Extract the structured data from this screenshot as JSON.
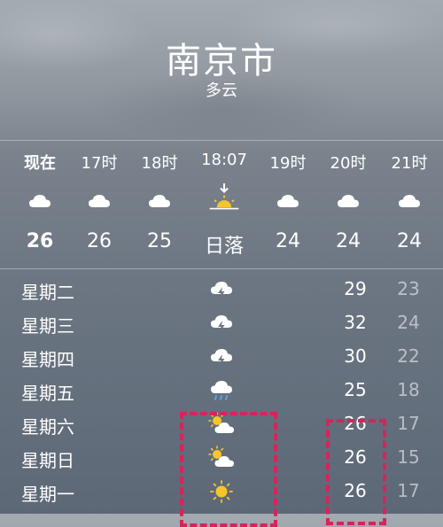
{
  "header": {
    "city": "南京市",
    "condition": "多云"
  },
  "hourly": [
    {
      "time": "现在",
      "icon": "cloud-icon",
      "temp": "26"
    },
    {
      "time": "17时",
      "icon": "cloud-icon",
      "temp": "26"
    },
    {
      "time": "18时",
      "icon": "cloud-icon",
      "temp": "25"
    },
    {
      "time": "18:07",
      "icon": "sunset-icon",
      "temp": "日落"
    },
    {
      "time": "19时",
      "icon": "cloud-icon",
      "temp": "24"
    },
    {
      "time": "20时",
      "icon": "cloud-icon",
      "temp": "24"
    },
    {
      "time": "21时",
      "icon": "cloud-icon",
      "temp": "24"
    }
  ],
  "daily": [
    {
      "day": "星期二",
      "icon": "thunderstorm-icon",
      "high": "29",
      "low": "23"
    },
    {
      "day": "星期三",
      "icon": "thunderstorm-icon",
      "high": "32",
      "low": "24"
    },
    {
      "day": "星期四",
      "icon": "thunderstorm-icon",
      "high": "30",
      "low": "22"
    },
    {
      "day": "星期五",
      "icon": "rain-icon",
      "high": "25",
      "low": "18"
    },
    {
      "day": "星期六",
      "icon": "partly-sunny-icon",
      "high": "26",
      "low": "17"
    },
    {
      "day": "星期日",
      "icon": "partly-sunny-icon",
      "high": "26",
      "low": "15"
    },
    {
      "day": "星期一",
      "icon": "sun-icon",
      "high": "26",
      "low": "17"
    }
  ],
  "colors": {
    "highlight": "#d6245a",
    "sun": "#f7c52b"
  }
}
